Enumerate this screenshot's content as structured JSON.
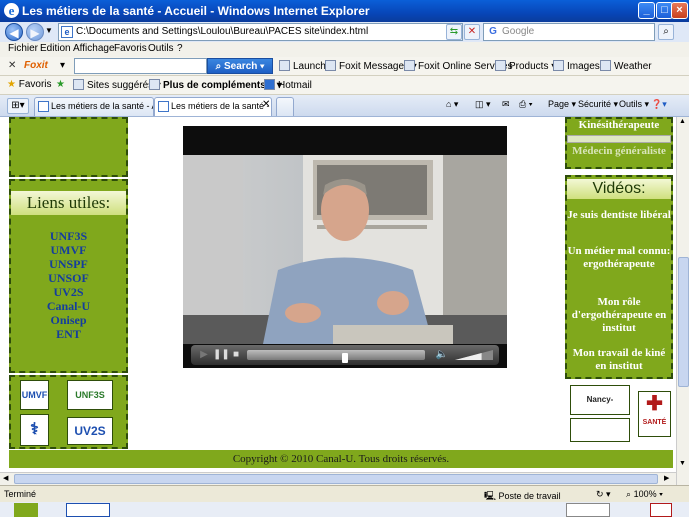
{
  "window": {
    "title": "Les métiers de la santé - Accueil - Windows Internet Explorer",
    "buttons": {
      "minimize": "_",
      "maximize": "□",
      "close": "×"
    }
  },
  "address_bar": {
    "url": "C:\\Documents and Settings\\Loulou\\Bureau\\PACES site\\index.html",
    "search_placeholder": "Google"
  },
  "menu": [
    "Fichier",
    "Edition",
    "Affichage",
    "Favoris",
    "Outils",
    "?"
  ],
  "foxit_toolbar": {
    "brand": "Foxit",
    "search_label": "Search",
    "items": [
      "Launch",
      "Foxit Messages",
      "Foxit Online Services",
      "Products",
      "Images",
      "Weather"
    ]
  },
  "favorites_bar": {
    "favoris": "Favoris",
    "items": [
      "Sites suggérés",
      "Plus de compléments...",
      "Hotmail"
    ]
  },
  "tabs": [
    {
      "label": "Les métiers de la santé - Acc..."
    },
    {
      "label": "Les métiers de la santé - ..."
    }
  ],
  "command_bar": [
    "Page",
    "Sécurité",
    "Outils"
  ],
  "page": {
    "left": {
      "liens_title": "Liens utiles:",
      "links": [
        "UNF3S",
        "UMVF",
        "UNSPF",
        "UNSOF",
        "UV2S",
        "Canal-U",
        "Onisep",
        "ENT"
      ],
      "logos": [
        "UMVF",
        "UNF3S",
        "",
        "UV2S"
      ]
    },
    "right": {
      "jobs_top": [
        "Kinésithérapeute",
        "Médecin généraliste"
      ],
      "videos_title": "Vidéos:",
      "videos": [
        "Je suis dentiste libéral",
        "Un métier mal connu: ergothérapeute",
        "Mon rôle d'ergothérapeute en institut",
        "Mon travail de kiné en institut"
      ],
      "logos": [
        "Nancy-Université",
        "",
        "SANTÉ"
      ]
    },
    "video": {
      "progress": 0.55,
      "volume": 0.7
    },
    "footer": "Copyright © 2010 Canal-U. Tous droits réservés."
  },
  "status": {
    "left": "Terminé",
    "zone": "Poste de travail",
    "zoom": "100%"
  },
  "colors": {
    "accent_green": "#80a81c",
    "dark_green": "#2e4d0a",
    "link_blue": "#143d9e"
  }
}
